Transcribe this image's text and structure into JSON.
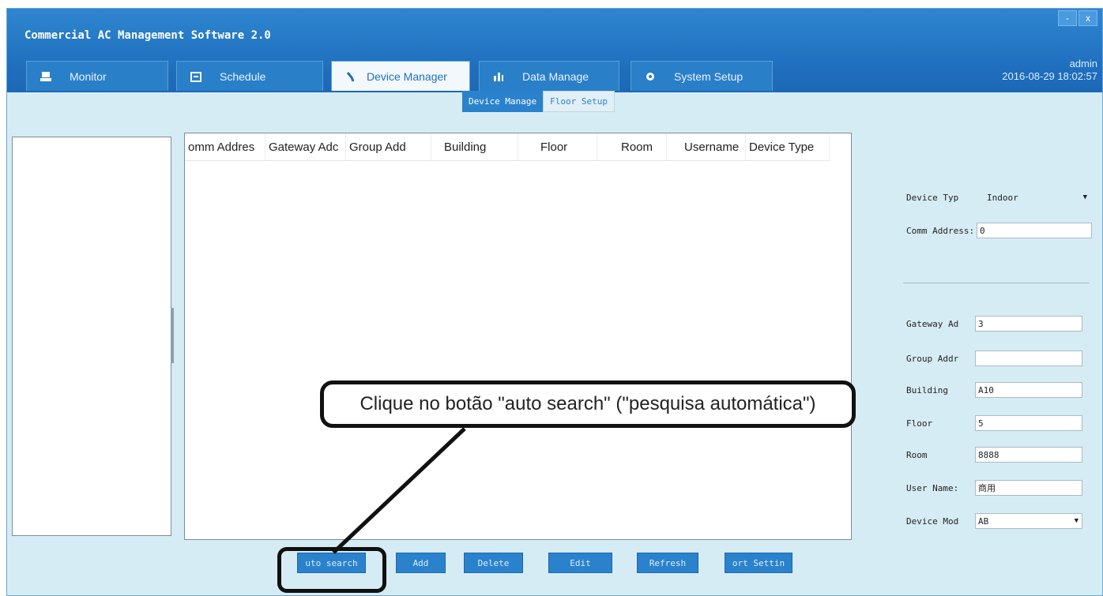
{
  "window": {
    "title": "Commercial AC Management Software 2.0",
    "controls": {
      "minimize": "-",
      "close": "x"
    }
  },
  "tabs": [
    {
      "label": "Monitor",
      "icon": "monitor-icon",
      "active": false
    },
    {
      "label": "Schedule",
      "icon": "calendar-icon",
      "active": false
    },
    {
      "label": "Device Manager",
      "icon": "wrench-icon",
      "active": true
    },
    {
      "label": "Data Manage",
      "icon": "bar-chart-icon",
      "active": false
    },
    {
      "label": "System Setup",
      "icon": "gear-icon",
      "active": false
    }
  ],
  "user": {
    "name": "admin",
    "datetime": "2016-08-29 18:02:57"
  },
  "subtabs": [
    {
      "label": "Device Manage",
      "active": true
    },
    {
      "label": "Floor Setup",
      "active": false
    }
  ],
  "table": {
    "columns": [
      "omm Addres",
      "Gateway Adc",
      "Group Add",
      "Building",
      "Floor",
      "Room",
      "Username",
      "Device Type"
    ],
    "rows": []
  },
  "form": {
    "device_type_label": "Device Typ",
    "device_type_value": "Indoor",
    "comm_address_label": "Comm Address:",
    "comm_address_value": "0",
    "gateway_label": "Gateway Ad",
    "gateway_value": "3",
    "group_label": "Group Addr",
    "group_value": "",
    "building_label": "Building",
    "building_value": "A10",
    "floor_label": "Floor",
    "floor_value": "5",
    "room_label": "Room",
    "room_value": "8888",
    "username_label": "User Name:",
    "username_value": "商用",
    "device_mod_label": "Device Mod",
    "device_mod_value": "AB"
  },
  "buttons": {
    "auto_search": "uto search",
    "add": "Add",
    "delete": "Delete",
    "edit": "Edit",
    "refresh": "Refresh",
    "port_setting": "ort Settin"
  },
  "annotation": {
    "callout_text": "Clique no botão \"auto search\" (\"pesquisa automática\")"
  },
  "colors": {
    "titlebar": "#1f6fbe",
    "background": "#d6ecf4",
    "button": "#2b82cc"
  }
}
